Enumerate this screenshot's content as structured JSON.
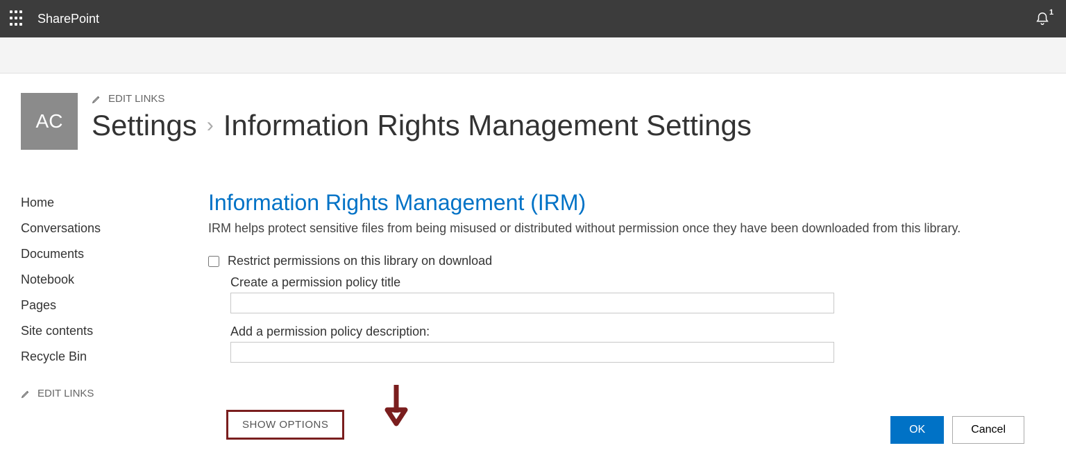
{
  "suite": {
    "brand": "SharePoint",
    "notif_count": "1"
  },
  "site": {
    "logo_initials": "AC",
    "edit_links_label": "EDIT LINKS",
    "breadcrumb_parent": "Settings",
    "breadcrumb_current": "Information Rights Management Settings"
  },
  "left_nav": {
    "items": [
      "Home",
      "Conversations",
      "Documents",
      "Notebook",
      "Pages",
      "Site contents",
      "Recycle Bin"
    ],
    "edit_links_label": "EDIT LINKS"
  },
  "irm": {
    "heading": "Information Rights Management (IRM)",
    "description": "IRM helps protect sensitive files from being misused or distributed without permission once they have been downloaded from this library.",
    "restrict_label": "Restrict permissions on this library on download",
    "title_field_label": "Create a permission policy title",
    "title_field_value": "",
    "desc_field_label": "Add a permission policy description:",
    "desc_field_value": "",
    "show_options_label": "SHOW OPTIONS"
  },
  "buttons": {
    "ok": "OK",
    "cancel": "Cancel"
  }
}
